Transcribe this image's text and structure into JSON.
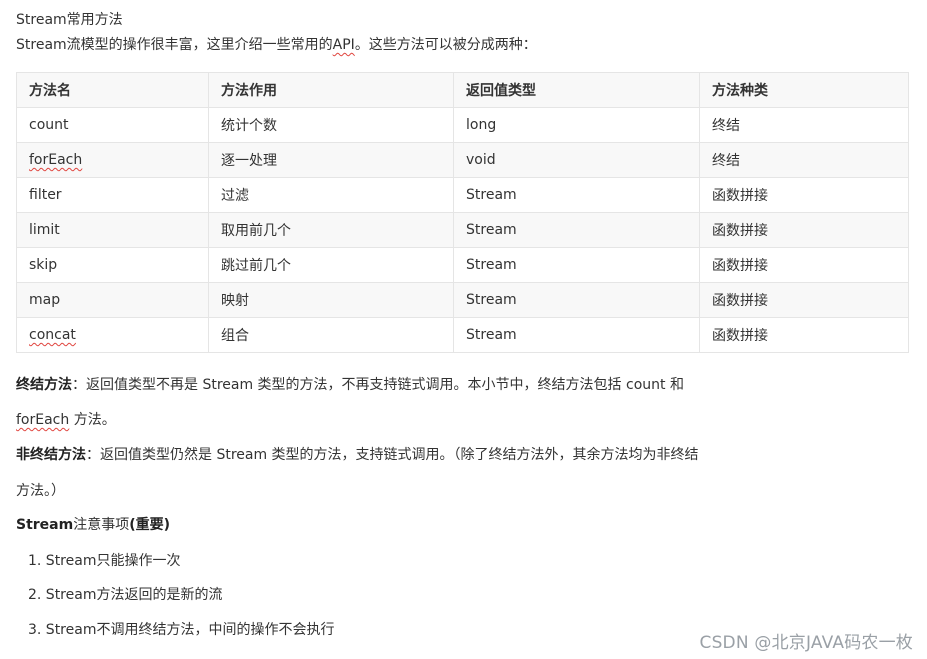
{
  "heading": "Stream常用方法",
  "intro_before": "Stream流模型的操作很丰富，这里介绍一些常用的",
  "intro_api": "API",
  "intro_after": "。这些方法可以被分成两种：",
  "table": {
    "headers": [
      "方法名",
      "方法作用",
      "返回值类型",
      "方法种类"
    ],
    "rows": [
      {
        "name": "count",
        "action": "统计个数",
        "ret": "long",
        "kind": "终结"
      },
      {
        "name": "forEach",
        "action": "逐一处理",
        "ret": "void",
        "kind": "终结"
      },
      {
        "name": "filter",
        "action": "过滤",
        "ret": "Stream",
        "kind": "函数拼接"
      },
      {
        "name": "limit",
        "action": "取用前几个",
        "ret": "Stream",
        "kind": "函数拼接"
      },
      {
        "name": "skip",
        "action": "跳过前几个",
        "ret": "Stream",
        "kind": "函数拼接"
      },
      {
        "name": "map",
        "action": "映射",
        "ret": "Stream",
        "kind": "函数拼接"
      },
      {
        "name": "concat",
        "action": "组合",
        "ret": "Stream",
        "kind": "函数拼接"
      }
    ]
  },
  "terminal": {
    "label": "终结方法",
    "text1": "：返回值类型不再是 Stream 类型的方法，不再支持链式调用。本小节中，终结方法包括 count 和",
    "foreach": "forEach",
    "text2": " 方法。"
  },
  "nonterminal": {
    "label": "非终结方法",
    "text1": "：返回值类型仍然是 Stream 类型的方法，支持链式调用。（除了终结方法外，其余方法均为非终结",
    "text2": "方法。）"
  },
  "notes": {
    "title_bold1": "Stream",
    "title_mid": "注意事项",
    "title_bold2": "(重要)",
    "items": [
      "1. Stream只能操作一次",
      "2. Stream方法返回的是新的流",
      "3. Stream不调用终结方法，中间的操作不会执行"
    ]
  },
  "watermark": "CSDN @北京JAVA码农一枚"
}
